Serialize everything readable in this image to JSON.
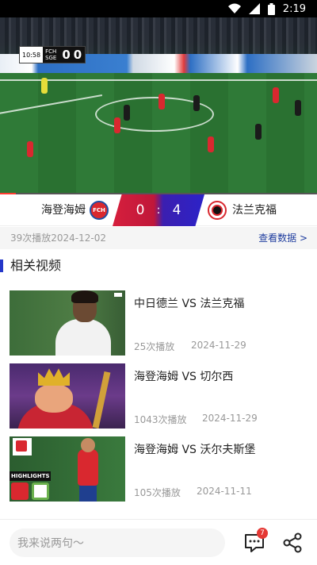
{
  "status_bar": {
    "time": "2:19",
    "icons": [
      "wifi-icon",
      "signal-icon",
      "battery-icon"
    ]
  },
  "player": {
    "overlay": {
      "clock": "10:58",
      "home_abbr": "FCH",
      "away_abbr": "SGE",
      "home_score": "0",
      "away_score": "0"
    },
    "progress_fraction": 0.05
  },
  "match": {
    "home_team": "海登海姆",
    "away_team": "法兰克福",
    "home_logo_text": "FCH",
    "home_score": "0",
    "separator": ":",
    "away_score": "4",
    "colors": {
      "home": "#d61f3d",
      "away": "#2c22c8"
    }
  },
  "meta": {
    "info": "39次播放2024-12-02",
    "view_data_link": "查看数据 >"
  },
  "related": {
    "title": "相关视频",
    "videos": [
      {
        "title": "中日德兰 VS 法兰克福",
        "plays": "25次播放",
        "date": "2024-11-29"
      },
      {
        "title": "海登海姆 VS 切尔西",
        "plays": "1043次播放",
        "date": "2024-11-29"
      },
      {
        "title": "海登海姆 VS 沃尔夫斯堡",
        "plays": "105次播放",
        "date": "2024-11-11",
        "thumb_label": "HIGHLIGHTS"
      }
    ]
  },
  "bottom_bar": {
    "comment_placeholder": "我来说两句～",
    "comment_count": "7",
    "icons": [
      "comment-icon",
      "share-icon"
    ]
  },
  "accent_color": "#2437c9"
}
